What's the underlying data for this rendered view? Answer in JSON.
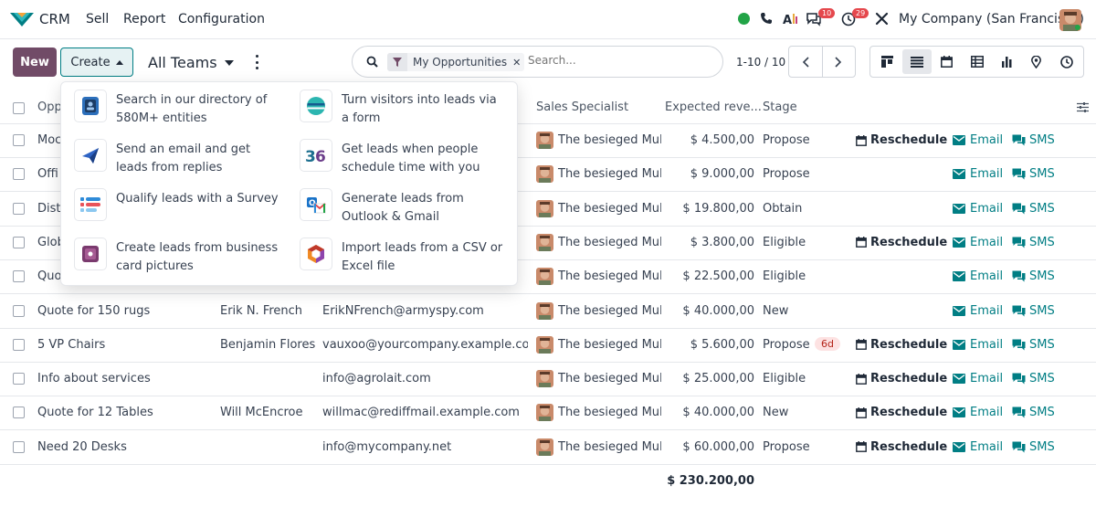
{
  "app": {
    "name": "CRM"
  },
  "nav": {
    "menus": [
      "Sell",
      "Report",
      "Configuration"
    ],
    "messages_count": "10",
    "activities_count": "29",
    "company": "My Company (San Francisco)"
  },
  "controls": {
    "new_label": "New",
    "create_label": "Create",
    "teams_label": "All Teams"
  },
  "search": {
    "facet": "My Opportunities",
    "placeholder": "Search..."
  },
  "pager": {
    "value": "1-10 / 10"
  },
  "columns": [
    "Opp",
    "Sales Specialist",
    "Expected reve...",
    "Stage"
  ],
  "dropdown": [
    "Search in our directory of 580M+ entities",
    "Turn visitors into leads via a form",
    "Send an email and get leads from replies",
    "Get leads when people schedule time with you",
    "Qualify leads with a Survey",
    "Generate leads from Outlook & Gmail",
    "Create leads from business card pictures",
    "Import leads from a CSV or Excel file"
  ],
  "labels": {
    "reschedule": "Reschedule",
    "email": "Email",
    "sms": "SMS"
  },
  "rows": [
    {
      "name": "Moc",
      "contact": "",
      "email": "",
      "specialist": "The besieged Mulla",
      "revenue": "$ 4.500,00",
      "stage": "Propose",
      "overdue": "",
      "reschedule": true
    },
    {
      "name": "Offi",
      "contact": "",
      "email": "",
      "specialist": "The besieged Mulla",
      "revenue": "$ 9.000,00",
      "stage": "Propose",
      "overdue": "",
      "reschedule": false
    },
    {
      "name": "Dist",
      "contact": "",
      "email": "",
      "specialist": "The besieged Mulla",
      "revenue": "$ 19.800,00",
      "stage": "Obtain",
      "overdue": "",
      "reschedule": false
    },
    {
      "name": "Glob",
      "contact": "",
      "email": "",
      "specialist": "The besieged Mulla",
      "revenue": "$ 3.800,00",
      "stage": "Eligible",
      "overdue": "",
      "reschedule": true
    },
    {
      "name": "Quo",
      "contact": "",
      "email": "",
      "specialist": "The besieged Mulla",
      "revenue": "$ 22.500,00",
      "stage": "Eligible",
      "overdue": "",
      "reschedule": false
    },
    {
      "name": "Quote for 150 rugs",
      "contact": "Erik N. French",
      "email": "ErikNFrench@armyspy.com",
      "specialist": "The besieged Mulla",
      "revenue": "$ 40.000,00",
      "stage": "New",
      "overdue": "",
      "reschedule": false
    },
    {
      "name": "5 VP Chairs",
      "contact": "Benjamin Flores",
      "email": "vauxoo@yourcompany.example.com",
      "specialist": "The besieged Mulla",
      "revenue": "$ 5.600,00",
      "stage": "Propose",
      "overdue": "6d",
      "reschedule": true
    },
    {
      "name": "Info about services",
      "contact": "",
      "email": "info@agrolait.com",
      "specialist": "The besieged Mulla",
      "revenue": "$ 25.000,00",
      "stage": "Eligible",
      "overdue": "",
      "reschedule": true
    },
    {
      "name": "Quote for 12 Tables",
      "contact": "Will McEncroe",
      "email": "willmac@rediffmail.example.com",
      "specialist": "The besieged Mulla",
      "revenue": "$ 40.000,00",
      "stage": "New",
      "overdue": "",
      "reschedule": true
    },
    {
      "name": "Need 20 Desks",
      "contact": "",
      "email": "info@mycompany.net",
      "specialist": "The besieged Mulla",
      "revenue": "$ 60.000,00",
      "stage": "Propose",
      "overdue": "",
      "reschedule": true
    }
  ],
  "total": "$ 230.200,00",
  "colors": {
    "primary": "#714b67",
    "teal": "#017e84",
    "danger": "#e5484d"
  }
}
